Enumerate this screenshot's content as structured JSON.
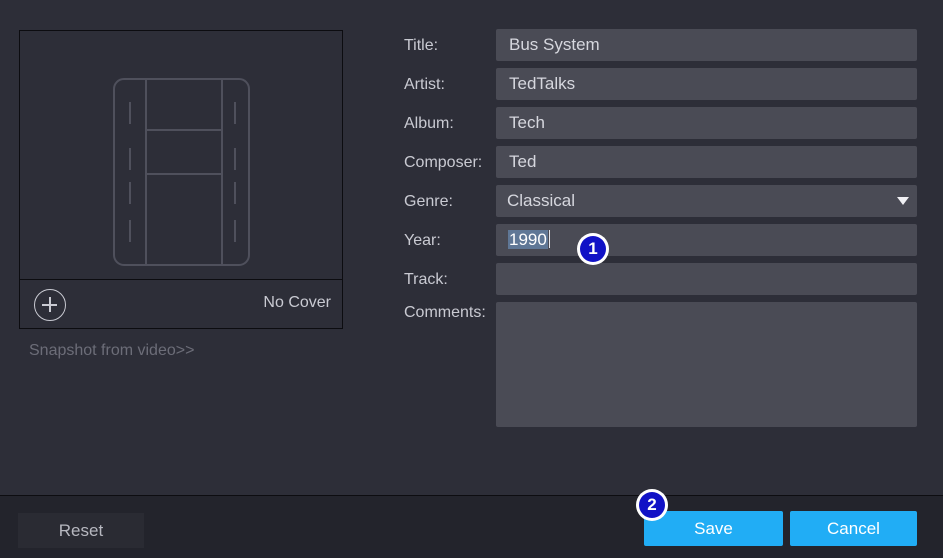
{
  "cover": {
    "no_cover_label": "No Cover",
    "snapshot_link": "Snapshot from video>>",
    "placeholder_icon": "film-icon",
    "add_icon": "plus-circle-icon"
  },
  "form": {
    "title": {
      "label": "Title:",
      "value": "Bus System"
    },
    "artist": {
      "label": "Artist:",
      "value": "TedTalks"
    },
    "album": {
      "label": "Album:",
      "value": "Tech"
    },
    "composer": {
      "label": "Composer:",
      "value": "Ted"
    },
    "genre": {
      "label": "Genre:",
      "value": "Classical"
    },
    "year": {
      "label": "Year:",
      "value": "1990"
    },
    "track": {
      "label": "Track:",
      "value": ""
    },
    "comments": {
      "label": "Comments:",
      "value": ""
    }
  },
  "callouts": {
    "first": "1",
    "second": "2"
  },
  "buttons": {
    "reset": "Reset",
    "save": "Save",
    "cancel": "Cancel"
  },
  "colors": {
    "accent": "#21adf5",
    "callout": "#1112c6",
    "background": "#2d2e38"
  }
}
